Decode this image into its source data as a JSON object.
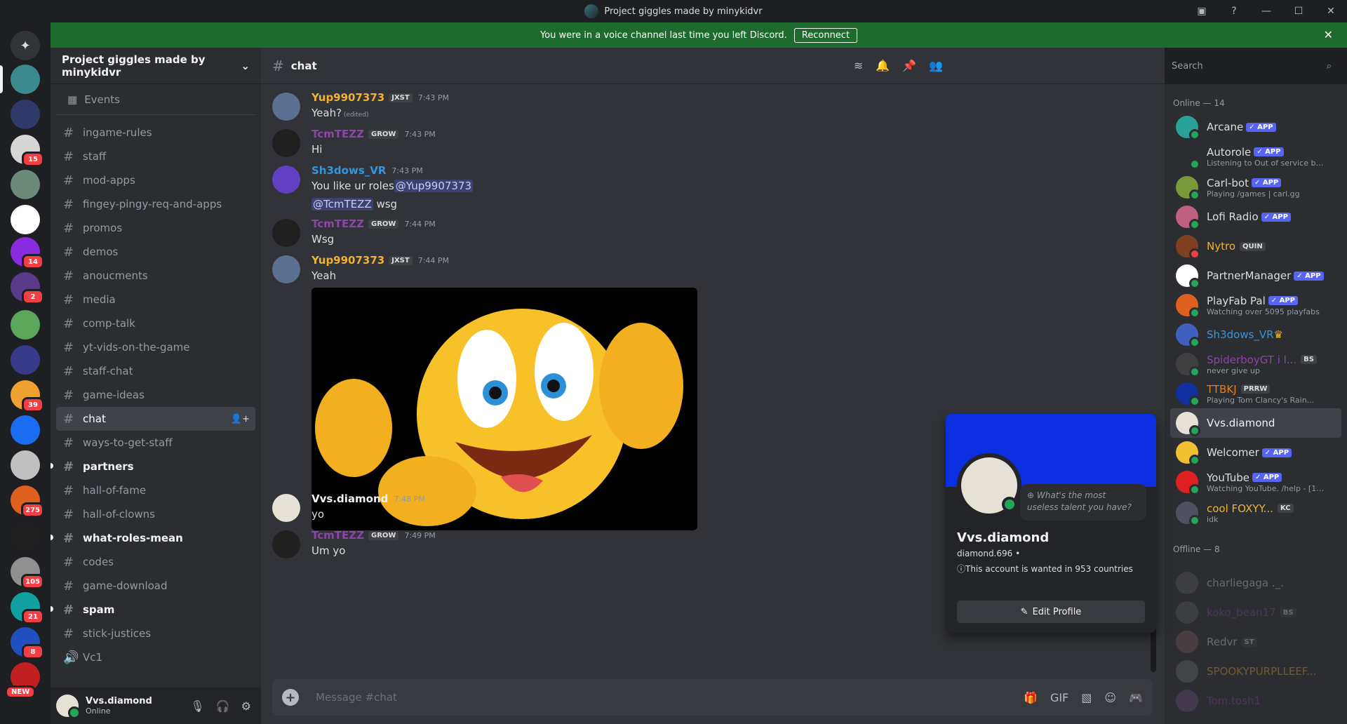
{
  "window": {
    "title": "Project giggles made by minykidvr"
  },
  "banner": {
    "text": "You were in a voice channel last time you left Discord.",
    "button": "Reconnect"
  },
  "servers": [
    {
      "color": "#5865f2"
    },
    {
      "color": "#3a8a8f",
      "selected": true
    },
    {
      "color": "#2f3a6b"
    },
    {
      "color": "#d6d6d6",
      "badge": "15"
    },
    {
      "color": "#6b8a7a"
    },
    {
      "color": "#ffffff"
    },
    {
      "color": "#8a2be2",
      "badge": "14"
    },
    {
      "color": "#5a3b8a",
      "badge": "2"
    },
    {
      "color": "#5aa65a"
    },
    {
      "color": "#3a3a8a"
    },
    {
      "color": "#f0a030",
      "badge": "39"
    },
    {
      "color": "#1a6cf0"
    },
    {
      "color": "#c0c0c0"
    },
    {
      "color": "#e06020",
      "badge": "275"
    },
    {
      "color": "#202020"
    },
    {
      "color": "#909090",
      "badge": "105"
    },
    {
      "color": "#10a0a0",
      "badge": "21"
    },
    {
      "color": "#2050c0",
      "badge": "8"
    },
    {
      "color": "#c02020",
      "new": "NEW"
    }
  ],
  "sidebar": {
    "guild_name": "Project giggles made by minykidvr",
    "events": "Events",
    "channels": [
      {
        "name": "ingame-rules"
      },
      {
        "name": "staff"
      },
      {
        "name": "mod-apps"
      },
      {
        "name": "fingey-pingy-req-and-apps"
      },
      {
        "name": "promos"
      },
      {
        "name": "demos"
      },
      {
        "name": "anoucments"
      },
      {
        "name": "media"
      },
      {
        "name": "comp-talk"
      },
      {
        "name": "yt-vids-on-the-game"
      },
      {
        "name": "staff-chat"
      },
      {
        "name": "game-ideas"
      },
      {
        "name": "chat",
        "active": true
      },
      {
        "name": "ways-to-get-staff"
      },
      {
        "name": "partners",
        "unread": true
      },
      {
        "name": "hall-of-fame"
      },
      {
        "name": "hall-of-clowns"
      },
      {
        "name": "what-roles-mean",
        "unread": true
      },
      {
        "name": "codes"
      },
      {
        "name": "game-download"
      },
      {
        "name": "spam",
        "unread": true
      },
      {
        "name": "stick-justices"
      },
      {
        "name": "Vc1",
        "voice": true
      }
    ]
  },
  "user": {
    "name": "Vvs.diamond",
    "status": "Online"
  },
  "channel": {
    "name": "chat",
    "search_placeholder": "Search"
  },
  "messages": [
    {
      "author": "Yup9907373",
      "color": "#f0b232",
      "tag": "JXST",
      "time": "7:43 PM",
      "text": "Yeah?",
      "edited": "(edited)"
    },
    {
      "author": "TcmTEZZ",
      "color": "#8e44ad",
      "tag": "GROW",
      "time": "7:43 PM",
      "text": "Hi"
    },
    {
      "author": "Sh3dows_VR",
      "color": "#3498db",
      "time": "7:43 PM",
      "text": "You like ur roles",
      "mention1": "@Yup9907373",
      "mention2": "@TcmTEZZ",
      "text2": "wsg"
    },
    {
      "author": "TcmTEZZ",
      "color": "#8e44ad",
      "tag": "GROW",
      "time": "7:44 PM",
      "text": "Wsg"
    },
    {
      "author": "Yup9907373",
      "color": "#f0b232",
      "tag": "JXST",
      "time": "7:44 PM",
      "text": "Yeah"
    },
    {
      "author": "Vvs.diamond",
      "color": "#f2f3f5",
      "time": "7:48 PM",
      "text": "yo"
    },
    {
      "author": "TcmTEZZ",
      "color": "#8e44ad",
      "tag": "GROW",
      "time": "7:49 PM",
      "text": "Um yo"
    }
  ],
  "composer": {
    "placeholder": "Message #chat"
  },
  "members": {
    "online_header": "Online — 14",
    "offline_header": "Offline — 8",
    "online": [
      {
        "name": "Arcane",
        "app": "APP",
        "color": "#dbdee1",
        "av": "#2aa198"
      },
      {
        "name": "Autorole",
        "app": "APP",
        "sub": "Listening to Out of service by ...",
        "color": "#dbdee1",
        "av": "#2b2d31"
      },
      {
        "name": "Carl-bot",
        "app": "APP",
        "sub": "Playing /games | carl.gg",
        "color": "#dbdee1",
        "av": "#7a9a3a"
      },
      {
        "name": "Lofi Radio",
        "app": "APP",
        "color": "#dbdee1",
        "av": "#c06080"
      },
      {
        "name": "Nytro",
        "guild": "QUIN",
        "color": "#f0b232",
        "av": "#804020",
        "dnd": true
      },
      {
        "name": "PartnerManager",
        "app": "APP",
        "color": "#dbdee1",
        "av": "#ffffff"
      },
      {
        "name": "PlayFab Pal",
        "app": "APP",
        "sub": "Watching over 5095 playfabs",
        "color": "#dbdee1",
        "av": "#e06020"
      },
      {
        "name": "Sh3dows_VR",
        "crown": "♛",
        "color": "#3498db",
        "av": "#4060c0"
      },
      {
        "name": "SpiderboyGT i l...",
        "guild": "BS",
        "sub": "never give up",
        "color": "#8e44ad",
        "av": "#404040"
      },
      {
        "name": "TTBKJ",
        "guild": "PRRW",
        "sub": "Playing Tom Clancy's Rain...",
        "color": "#e67e22",
        "av": "#1030a0"
      },
      {
        "name": "Vvs.diamond",
        "color": "#f2f3f5",
        "av": "#e6e1d6",
        "sel": true
      },
      {
        "name": "Welcomer",
        "app": "APP",
        "color": "#dbdee1",
        "av": "#f0c030"
      },
      {
        "name": "YouTube",
        "app": "APP",
        "sub": "Watching YouTube. /help - [18...",
        "color": "#dbdee1",
        "av": "#e02020"
      },
      {
        "name": "cool FOXYY...",
        "guild": "KC",
        "sub": "idk",
        "color": "#f0b232",
        "av": "#505060"
      }
    ],
    "offline": [
      {
        "name": "charliegaga ._.",
        "color": "#dbdee1",
        "av": "#606060"
      },
      {
        "name": "koko_bean17",
        "guild": "BS",
        "color": "#8e44ad",
        "av": "#606060"
      },
      {
        "name": "Redvr",
        "guild": "ST",
        "color": "#dbdee1",
        "av": "#806060"
      },
      {
        "name": "SPOOKYPURPLLEEF...",
        "color": "#f0b232",
        "av": "#707070"
      },
      {
        "name": "Tom.tosh1",
        "color": "#8e44ad",
        "av": "#705080"
      }
    ]
  },
  "popout": {
    "name": "Vvs.diamond",
    "username": "diamond.696 •",
    "bio": "ⓘThis account is wanted in 953 countries",
    "bubble": "What's the most useless talent you have?",
    "button": "Edit Profile"
  }
}
